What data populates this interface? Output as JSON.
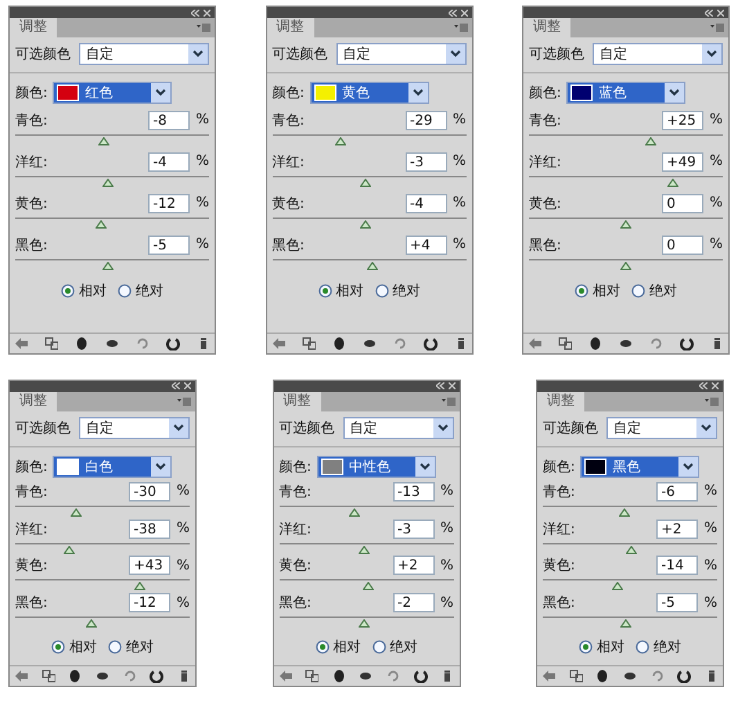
{
  "rows": [
    {
      "panels": [
        {
          "tab": "调整",
          "preset_label": "可选颜色",
          "preset": "自定",
          "color_label": "颜色:",
          "color_name": "红色",
          "color": "#d40010",
          "sliders": [
            {
              "label": "青色:",
              "value": "-8",
              "unit": "%",
              "level": 0.46
            },
            {
              "label": "洋红:",
              "value": "-4",
              "unit": "%",
              "level": 0.48
            },
            {
              "label": "黄色:",
              "value": "-12",
              "unit": "%",
              "level": 0.44
            },
            {
              "label": "黑色:",
              "value": "-5",
              "unit": "%",
              "level": 0.475
            }
          ],
          "radios": [
            {
              "label": "相对",
              "selected": true
            },
            {
              "label": "绝对",
              "selected": false
            }
          ]
        },
        {
          "tab": "调整",
          "preset_label": "可选颜色",
          "preset": "自定",
          "color_label": "颜色:",
          "color_name": "黄色",
          "color": "#f4f000",
          "sliders": [
            {
              "label": "青色:",
              "value": "-29",
              "unit": "%",
              "level": 0.355
            },
            {
              "label": "洋红:",
              "value": "-3",
              "unit": "%",
              "level": 0.485
            },
            {
              "label": "黄色:",
              "value": "-4",
              "unit": "%",
              "level": 0.48
            },
            {
              "label": "黑色:",
              "value": "+4",
              "unit": "%",
              "level": 0.52
            }
          ],
          "radios": [
            {
              "label": "相对",
              "selected": true
            },
            {
              "label": "绝对",
              "selected": false
            }
          ]
        },
        {
          "tab": "调整",
          "preset_label": "可选颜色",
          "preset": "自定",
          "color_label": "颜色:",
          "color_name": "蓝色",
          "color": "#000070",
          "sliders": [
            {
              "label": "青色:",
              "value": "+25",
              "unit": "%",
              "level": 0.625
            },
            {
              "label": "洋红:",
              "value": "+49",
              "unit": "%",
              "level": 0.745
            },
            {
              "label": "黄色:",
              "value": "0",
              "unit": "%",
              "level": 0.5
            },
            {
              "label": "黑色:",
              "value": "0",
              "unit": "%",
              "level": 0.5
            }
          ],
          "radios": [
            {
              "label": "相对",
              "selected": true
            },
            {
              "label": "绝对",
              "selected": false
            }
          ]
        }
      ]
    },
    {
      "panels": [
        {
          "tab": "调整",
          "preset_label": "可选颜色",
          "preset": "自定",
          "color_label": "颜色:",
          "color_name": "白色",
          "color": "#ffffff",
          "sliders": [
            {
              "label": "青色:",
              "value": "-30",
              "unit": "%",
              "level": 0.35
            },
            {
              "label": "洋红:",
              "value": "-38",
              "unit": "%",
              "level": 0.31
            },
            {
              "label": "黄色:",
              "value": "+43",
              "unit": "%",
              "level": 0.715
            },
            {
              "label": "黑色:",
              "value": "-12",
              "unit": "%",
              "level": 0.44
            }
          ],
          "radios": [
            {
              "label": "相对",
              "selected": true
            },
            {
              "label": "绝对",
              "selected": false
            }
          ]
        },
        {
          "tab": "调整",
          "preset_label": "可选颜色",
          "preset": "自定",
          "color_label": "颜色:",
          "color_name": "中性色",
          "color": "#808080",
          "sliders": [
            {
              "label": "青色:",
              "value": "-13",
              "unit": "%",
              "level": 0.435
            },
            {
              "label": "洋红:",
              "value": "-3",
              "unit": "%",
              "level": 0.485
            },
            {
              "label": "黄色:",
              "value": "+2",
              "unit": "%",
              "level": 0.51
            },
            {
              "label": "黑色:",
              "value": "-2",
              "unit": "%",
              "level": 0.49
            }
          ],
          "radios": [
            {
              "label": "相对",
              "selected": true
            },
            {
              "label": "绝对",
              "selected": false
            }
          ]
        },
        {
          "tab": "调整",
          "preset_label": "可选颜色",
          "preset": "自定",
          "color_label": "颜色:",
          "color_name": "黑色",
          "color": "#000010",
          "sliders": [
            {
              "label": "青色:",
              "value": "-6",
              "unit": "%",
              "level": 0.47
            },
            {
              "label": "洋红:",
              "value": "+2",
              "unit": "%",
              "level": 0.51
            },
            {
              "label": "黄色:",
              "value": "-14",
              "unit": "%",
              "level": 0.43
            },
            {
              "label": "黑色:",
              "value": "-5",
              "unit": "%",
              "level": 0.475
            }
          ],
          "radios": [
            {
              "label": "相对",
              "selected": true
            },
            {
              "label": "绝对",
              "selected": false
            }
          ]
        }
      ]
    }
  ]
}
